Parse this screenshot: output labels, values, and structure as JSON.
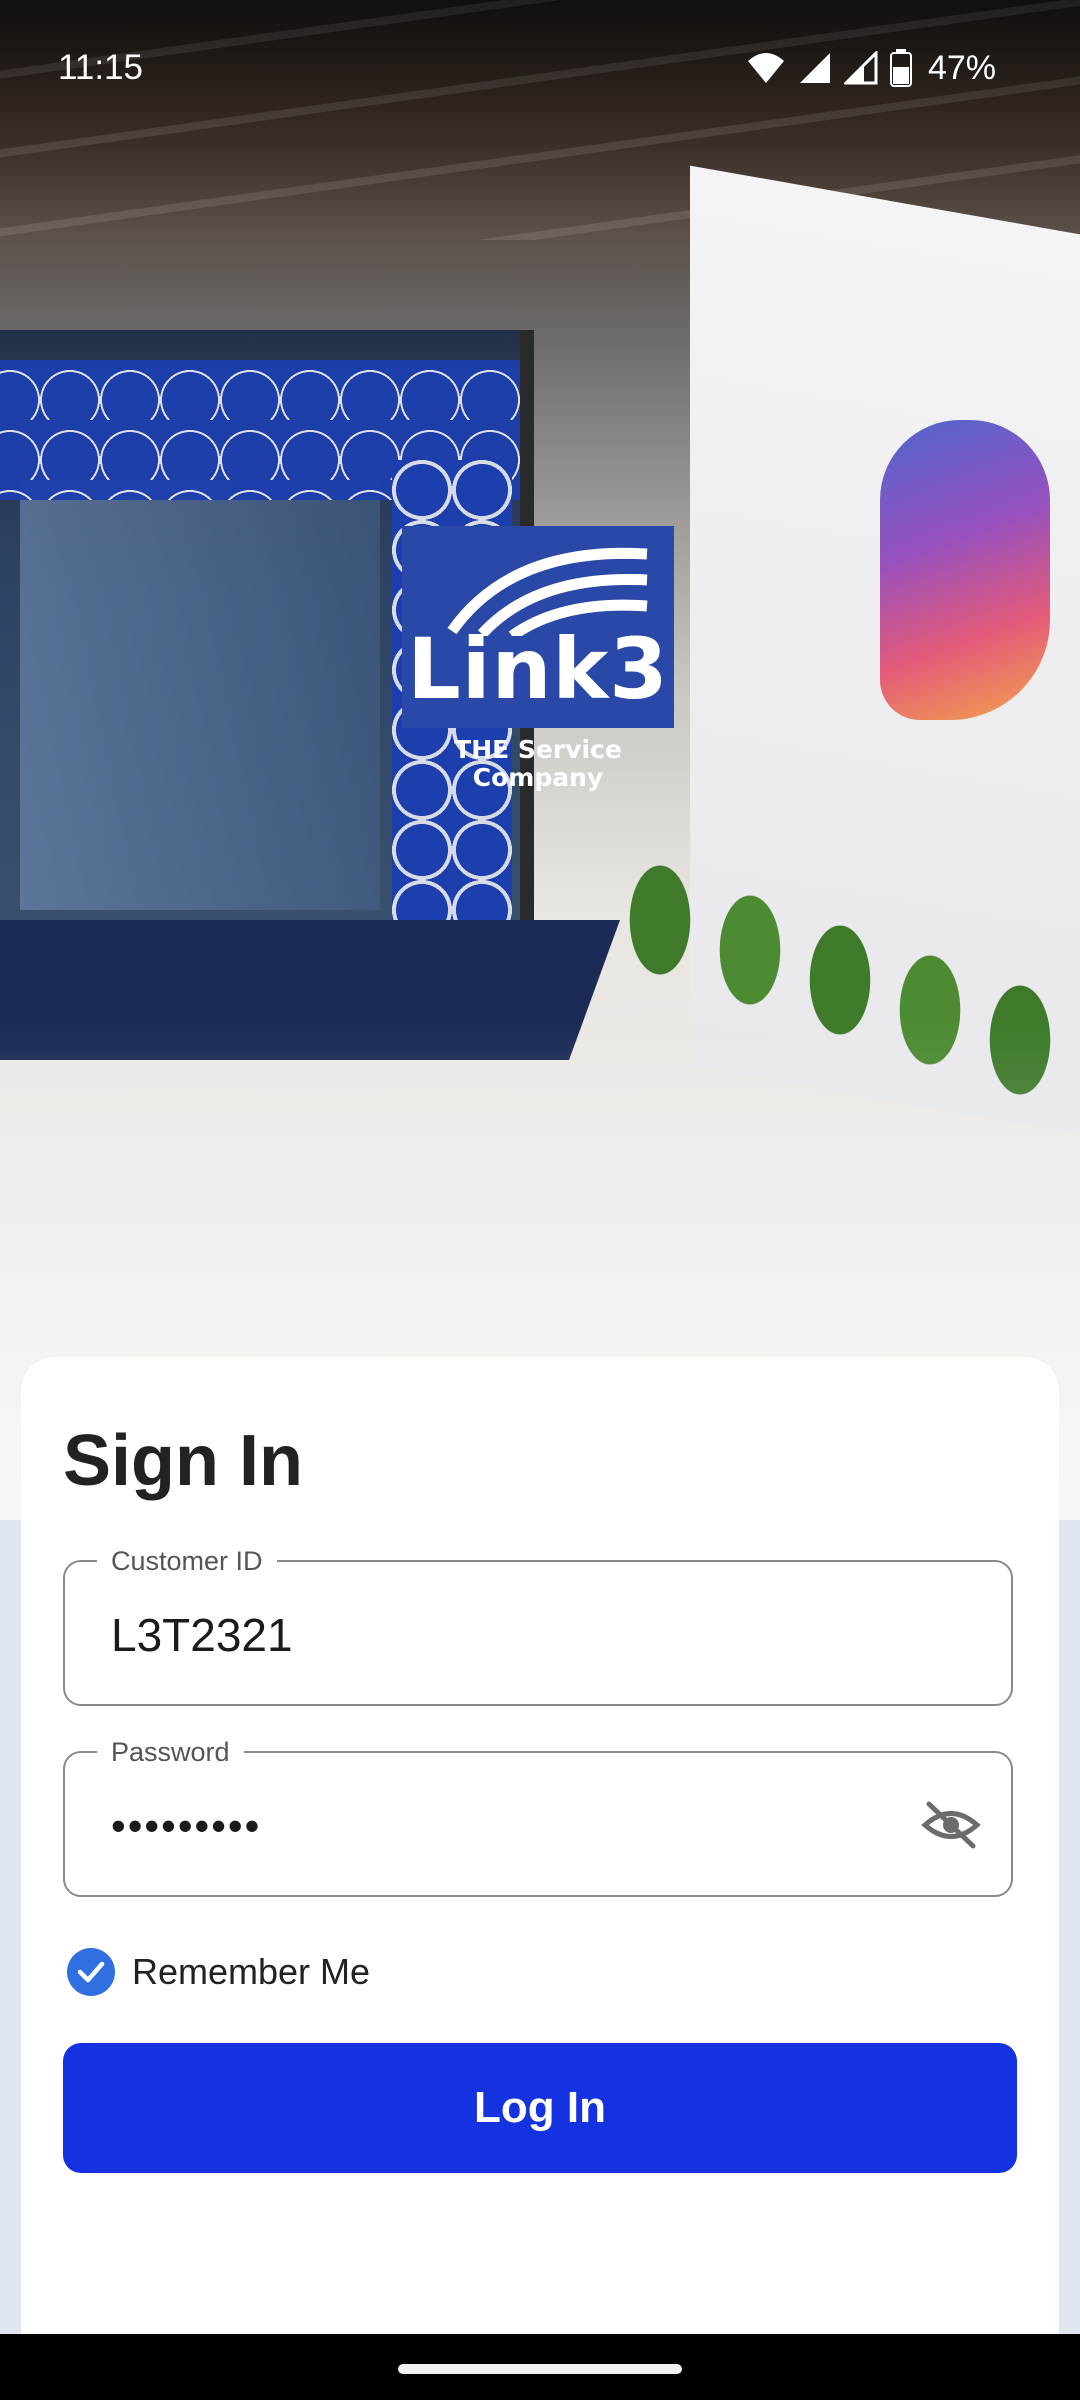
{
  "status_bar": {
    "time": "11:15",
    "battery_percent": "47%",
    "icons": [
      "wifi-icon",
      "signal-icon",
      "signal-icon",
      "battery-icon"
    ]
  },
  "logo": {
    "wordmark": "Link3",
    "tagline": "THE Service Company",
    "brand_color": "#2948a7"
  },
  "signin": {
    "title": "Sign In",
    "customer_id": {
      "label": "Customer ID",
      "value": "L3T2321"
    },
    "password": {
      "label": "Password",
      "value": "•••••••••",
      "toggle_icon": "eye-off-icon"
    },
    "remember_me": {
      "label": "Remember Me",
      "checked": true
    },
    "login_button": "Log In",
    "accent_color": "#1432e0"
  }
}
